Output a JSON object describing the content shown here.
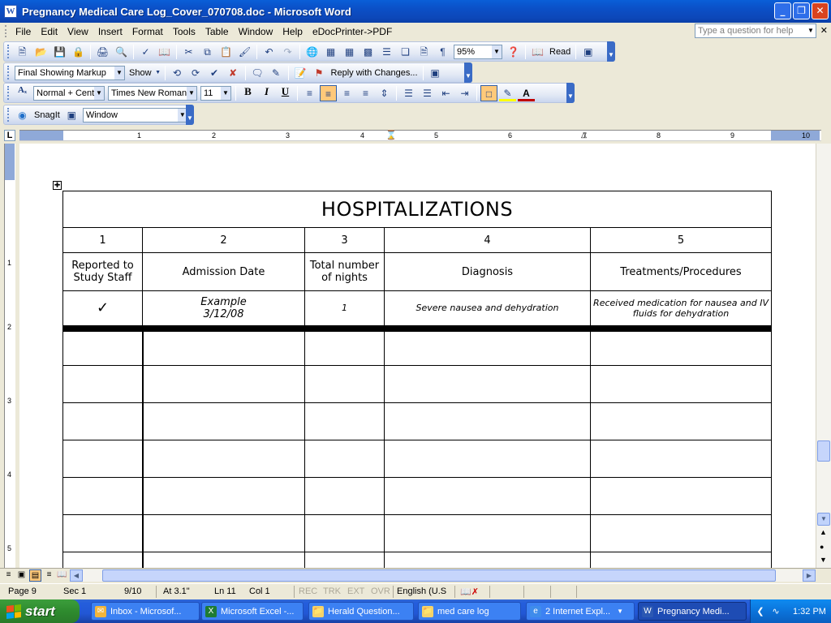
{
  "window": {
    "title": "Pregnancy Medical Care Log_Cover_070708.doc - Microsoft Word",
    "app_icon": "W"
  },
  "menu": {
    "items": [
      "File",
      "Edit",
      "View",
      "Insert",
      "Format",
      "Tools",
      "Table",
      "Window",
      "Help",
      "eDocPrinter->PDF"
    ],
    "help_placeholder": "Type a question for help"
  },
  "standard_toolbar": {
    "zoom": "95%",
    "read_label": "Read"
  },
  "reviewing_toolbar": {
    "markup_mode": "Final Showing Markup",
    "show_label": "Show",
    "reply_label": "Reply with Changes..."
  },
  "formatting_toolbar": {
    "style": "Normal + Cente",
    "font": "Times New Roman",
    "size": "11"
  },
  "snagit_toolbar": {
    "snagit_label": "SnagIt",
    "capture_mode": "Window"
  },
  "ruler": {
    "numbers": [
      "1",
      "2",
      "3",
      "4",
      "5",
      "6",
      "7",
      "8",
      "9",
      "10"
    ],
    "vertical_numbers": [
      "1",
      "2",
      "3",
      "4",
      "5"
    ]
  },
  "document": {
    "table_title": "HOSPITALIZATIONS",
    "column_numbers": [
      "1",
      "2",
      "3",
      "4",
      "5"
    ],
    "column_headers": [
      "Reported to Study Staff",
      "Admission Date",
      "Total number of nights",
      "Diagnosis",
      "Treatments/Procedures"
    ],
    "example_row": {
      "reported": "✓",
      "admission_line1": "Example",
      "admission_line2": "3/12/08",
      "nights": "1",
      "diagnosis": "Severe nausea and dehydration",
      "treatment": "Received medication for nausea and IV fluids for dehydration"
    },
    "empty_rows": 7
  },
  "status_bar": {
    "page": "Page  9",
    "sec": "Sec  1",
    "page_of": "9/10",
    "at": "At  3.1\"",
    "ln": "Ln  11",
    "col": "Col  1",
    "rec": "REC",
    "trk": "TRK",
    "ext": "EXT",
    "ovr": "OVR",
    "language": "English (U.S"
  },
  "taskbar": {
    "start_label": "start",
    "tasks": [
      {
        "label": "Inbox - Microsof...",
        "icon": "outlook-icon",
        "color": "#F2B53C"
      },
      {
        "label": "Microsoft Excel -...",
        "icon": "excel-icon",
        "color": "#1E7B34"
      },
      {
        "label": "Herald Question...",
        "icon": "folder-icon",
        "color": "#F5D36A"
      },
      {
        "label": "med care log",
        "icon": "folder-icon",
        "color": "#F5D36A"
      },
      {
        "label": "2 Internet Expl...",
        "icon": "ie-icon",
        "color": "#3F8CEB"
      },
      {
        "label": "Pregnancy Medi...",
        "icon": "word-icon",
        "color": "#2B58B3"
      }
    ],
    "clock": "1:32 PM"
  }
}
